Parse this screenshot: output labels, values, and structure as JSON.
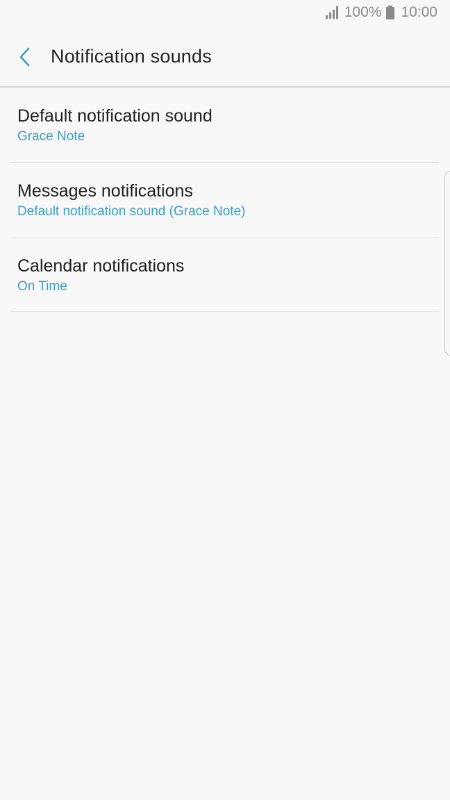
{
  "status_bar": {
    "battery_percent": "100%",
    "time": "10:00",
    "signal_icon": "signal-icon",
    "battery_icon": "battery-icon"
  },
  "header": {
    "back_icon": "chevron-left-icon",
    "title": "Notification sounds"
  },
  "items": [
    {
      "title": "Default notification sound",
      "subtitle": "Grace Note"
    },
    {
      "title": "Messages notifications",
      "subtitle": "Default notification sound (Grace Note)"
    },
    {
      "title": "Calendar notifications",
      "subtitle": "On Time"
    }
  ],
  "colors": {
    "accent": "#3a9fc4",
    "background": "#f8f8f8",
    "title_text": "#1f1f1f"
  }
}
